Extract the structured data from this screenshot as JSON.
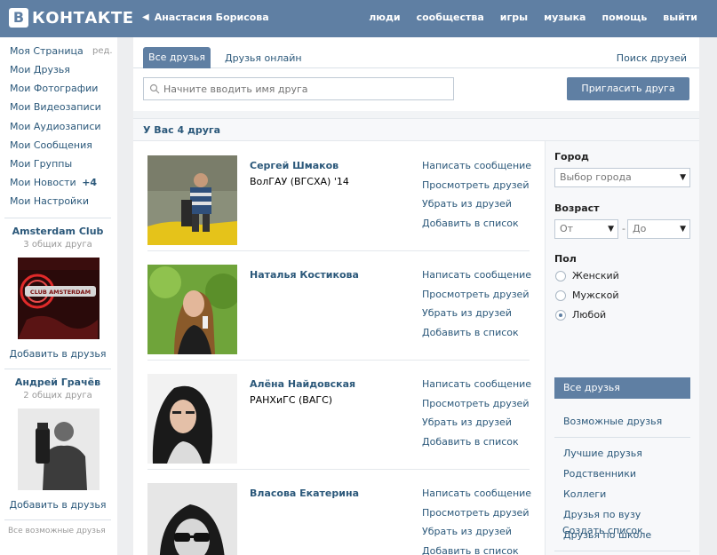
{
  "header": {
    "logo_letter": "В",
    "logo_text": "КОНТАКТЕ",
    "user_name": "Анастасия Борисова",
    "nav": [
      "люди",
      "сообщества",
      "игры",
      "музыка",
      "помощь",
      "выйти"
    ]
  },
  "left_menu": {
    "items": [
      "Моя Страница",
      "Мои Друзья",
      "Мои Фотографии",
      "Мои Видеозаписи",
      "Мои Аудиозаписи",
      "Мои Сообщения",
      "Мои Группы",
      "Мои Новости",
      "Мои Настройки"
    ],
    "edit_label": "ред.",
    "news_badge": "+4",
    "suggestions": [
      {
        "title": "Amsterdam Club",
        "subtitle": "3 общих друга",
        "action": "Добавить в друзья",
        "logo_text": "CLUB AMSTERDAM"
      },
      {
        "title": "Андрей Грачёв",
        "subtitle": "2 общих друга",
        "action": "Добавить в друзья"
      }
    ],
    "all_suggestions": "Все возможные друзья"
  },
  "tabs": {
    "all": "Все друзья",
    "online": "Друзья онлайн",
    "search": "Поиск друзей"
  },
  "search": {
    "placeholder": "Начните вводить имя друга",
    "invite_button": "Пригласить друга"
  },
  "friends_count_text": "У Вас 4 друга",
  "friends": [
    {
      "name": "Сергей Шмаков",
      "university": "ВолГАУ (ВГСХА) '14"
    },
    {
      "name": "Наталья Костикова",
      "university": ""
    },
    {
      "name": "Алёна Найдовская",
      "university": "РАНХиГС (ВАГС)"
    },
    {
      "name": "Власова Екатерина",
      "university": ""
    }
  ],
  "friend_actions": [
    "Написать сообщение",
    "Просмотреть друзей",
    "Убрать из друзей",
    "Добавить в список"
  ],
  "filter": {
    "city_label": "Город",
    "city_value": "Выбор города",
    "age_label": "Возраст",
    "age_from": "От",
    "age_dash": "-",
    "age_to": "До",
    "gender_label": "Пол",
    "genders": [
      "Женский",
      "Мужской",
      "Любой"
    ],
    "selected_gender": "Любой",
    "lists_active": "Все друзья",
    "possible": "Возможные друзья",
    "lists": [
      "Лучшие друзья",
      "Родственники",
      "Коллеги",
      "Друзья по вузу",
      "Друзья по школе"
    ],
    "create_list": "Создать список"
  },
  "colors": {
    "header": "#5f7fa3",
    "link": "#2b587a",
    "background": "#edeef0"
  }
}
